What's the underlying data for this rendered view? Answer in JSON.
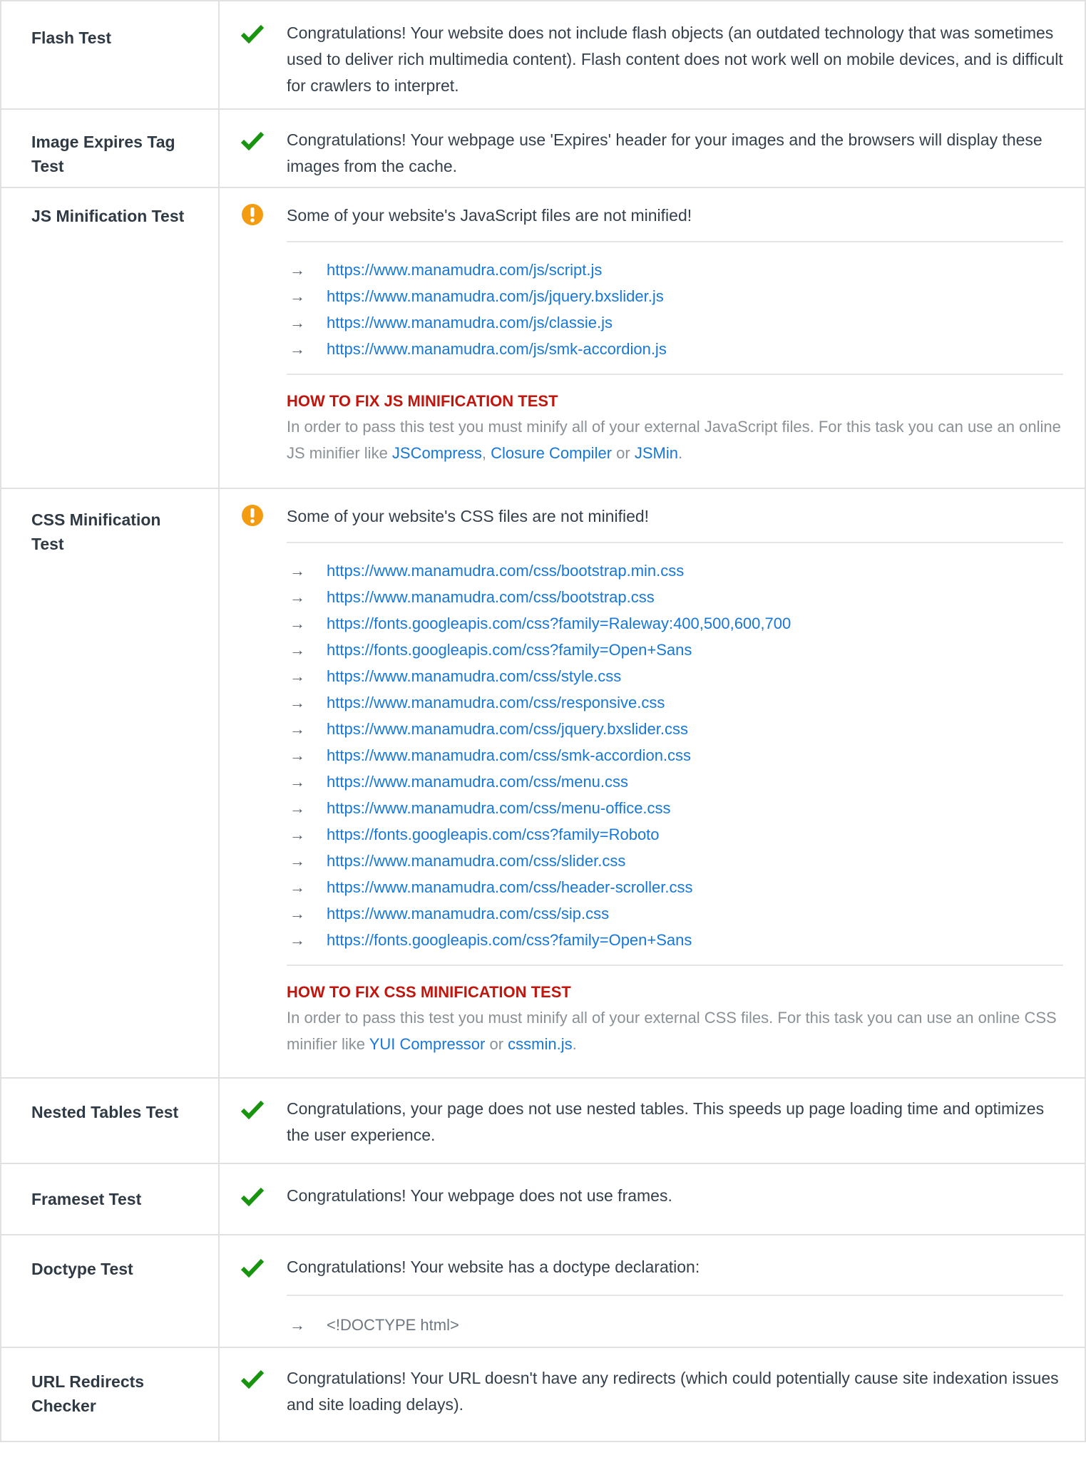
{
  "colors": {
    "check": "#19940f",
    "warn": "#f39c12",
    "link": "#1677d8",
    "fix_title": "#c0160e"
  },
  "rows": {
    "flash": {
      "name": "Flash Test",
      "icon": "check-icon",
      "message": "Congratulations! Your website does not include flash objects (an outdated technology that was sometimes used to deliver rich multimedia content). Flash content does not work well on mobile devices, and is difficult for crawlers to interpret."
    },
    "image_expires": {
      "name": "Image Expires Tag Test",
      "icon": "check-icon",
      "message": "Congratulations! Your webpage use 'Expires' header for your images and the browsers will display these images from the cache."
    },
    "js_min": {
      "name": "JS Minification Test",
      "icon": "warning-icon",
      "message": "Some of your website's JavaScript files are not minified!",
      "files": [
        "https://www.manamudra.com/js/script.js",
        "https://www.manamudra.com/js/jquery.bxslider.js",
        "https://www.manamudra.com/js/classie.js",
        "https://www.manamudra.com/js/smk-accordion.js"
      ],
      "fix_title": "HOW TO FIX JS MINIFICATION TEST",
      "fix_text_1": "In order to pass this test you must minify all of your external JavaScript files. For this task you can use an online JS minifier like ",
      "link_1": "JSCompress",
      "sep_1": ", ",
      "link_2": "Closure Compiler",
      "sep_2": " or ",
      "link_3": "JSMin",
      "end": "."
    },
    "css_min": {
      "name": "CSS Minification Test",
      "icon": "warning-icon",
      "message": "Some of your website's CSS files are not minified!",
      "files": [
        "https://www.manamudra.com/css/bootstrap.min.css",
        "https://www.manamudra.com/css/bootstrap.css",
        "https://fonts.googleapis.com/css?family=Raleway:400,500,600,700",
        "https://fonts.googleapis.com/css?family=Open+Sans",
        "https://www.manamudra.com/css/style.css",
        "https://www.manamudra.com/css/responsive.css",
        "https://www.manamudra.com/css/jquery.bxslider.css",
        "https://www.manamudra.com/css/smk-accordion.css",
        "https://www.manamudra.com/css/menu.css",
        "https://www.manamudra.com/css/menu-office.css",
        "https://fonts.googleapis.com/css?family=Roboto",
        "https://www.manamudra.com/css/slider.css",
        "https://www.manamudra.com/css/header-scroller.css",
        "https://www.manamudra.com/css/sip.css",
        "https://fonts.googleapis.com/css?family=Open+Sans"
      ],
      "fix_title": "HOW TO FIX CSS MINIFICATION TEST",
      "fix_text_1": "In order to pass this test you must minify all of your external CSS files. For this task you can use an online CSS minifier like ",
      "link_1": "YUI Compressor",
      "sep_1": " or ",
      "link_2": "cssmin.js",
      "end": "."
    },
    "nested_tables": {
      "name": "Nested Tables Test",
      "icon": "check-icon",
      "message": "Congratulations, your page does not use nested tables. This speeds up page loading time and optimizes the user experience."
    },
    "frameset": {
      "name": "Frameset Test",
      "icon": "check-icon",
      "message": "Congratulations! Your webpage does not use frames."
    },
    "doctype": {
      "name": "Doctype Test",
      "icon": "check-icon",
      "message": "Congratulations! Your website has a doctype declaration:",
      "declaration": "<!DOCTYPE html>"
    },
    "url_redirects": {
      "name": "URL Redirects Checker",
      "icon": "check-icon",
      "message": "Congratulations! Your URL doesn't have any redirects (which could potentially cause site indexation issues and site loading delays)."
    }
  }
}
